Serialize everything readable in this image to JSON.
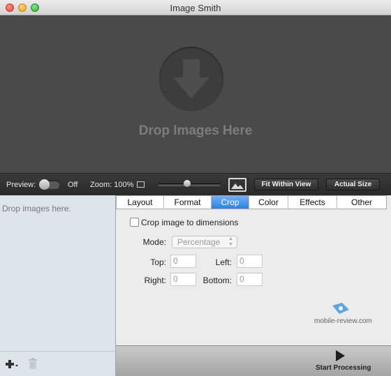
{
  "window": {
    "title": "Image Smith"
  },
  "dropzone": {
    "text": "Drop Images Here",
    "icon": "arrow-down-icon"
  },
  "preview_bar": {
    "preview_label": "Preview:",
    "preview_state": "Off",
    "zoom_label": "Zoom: 100%",
    "zoom_level": 0.5,
    "fit_button": "Fit Within View",
    "actual_button": "Actual Size"
  },
  "list": {
    "placeholder": "Drop images here.",
    "add_icon": "add-icon",
    "trash_icon": "trash-icon"
  },
  "tabs": [
    "Layout",
    "Format",
    "Crop",
    "Color",
    "Effects",
    "Other"
  ],
  "selected_tab": "Crop",
  "crop": {
    "checkbox_label": "Crop image to dimensions",
    "checked": false,
    "mode_label": "Mode:",
    "mode_value": "Percentage",
    "top_label": "Top:",
    "top_value": "0",
    "left_label": "Left:",
    "left_value": "0",
    "right_label": "Right:",
    "right_value": "0",
    "bottom_label": "Bottom:",
    "bottom_value": "0"
  },
  "watermark": "mobile-review.com",
  "bottom": {
    "start_label": "Start Processing"
  },
  "colors": {
    "accent": "#2f7fe3",
    "dropzone_bg": "#4a4a4a"
  }
}
